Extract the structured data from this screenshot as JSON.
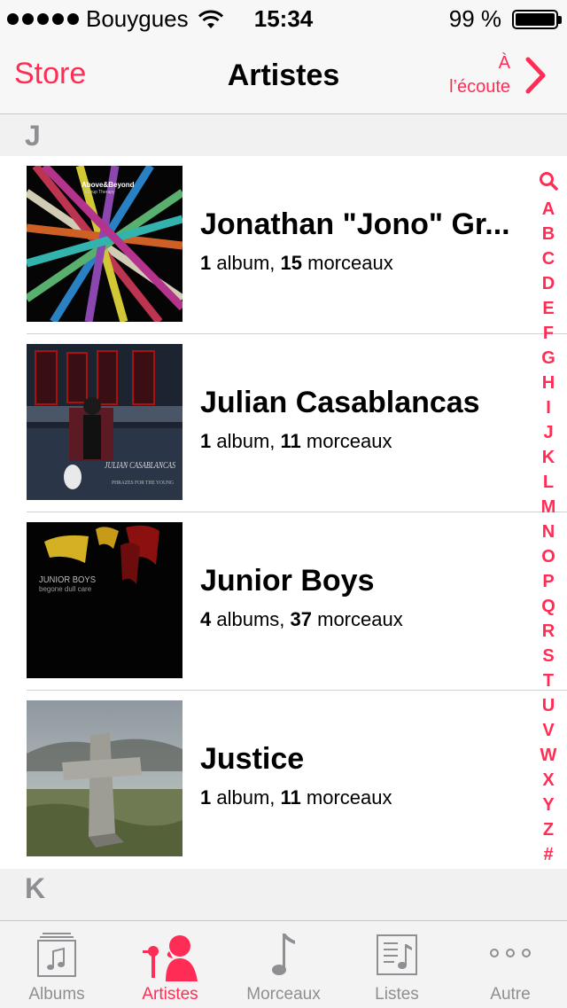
{
  "status_bar": {
    "carrier": "Bouygues",
    "time": "15:34",
    "battery_text": "99 %",
    "battery_level": 0.99
  },
  "nav": {
    "back_label": "Store",
    "title": "Artistes",
    "now_playing_line1": "À",
    "now_playing_line2": "l’écoute"
  },
  "sections": [
    {
      "letter": "J"
    },
    {
      "letter": "K"
    }
  ],
  "artists": [
    {
      "name": "Jonathan \"Jono\" Gr...",
      "albums_count": "1",
      "albums_word": " album, ",
      "tracks_count": "15",
      "tracks_word": " morceaux",
      "cover_text": "Above&Beyond",
      "cover_subtext": "Group Therapy"
    },
    {
      "name": "Julian Casablancas",
      "albums_count": "1",
      "albums_word": " album, ",
      "tracks_count": "11",
      "tracks_word": " morceaux",
      "cover_text": "JULIAN CASABLANCAS",
      "cover_subtext": "PHRAZES FOR THE YOUNG"
    },
    {
      "name": "Junior Boys",
      "albums_count": "4",
      "albums_word": " albums, ",
      "tracks_count": "37",
      "tracks_word": " morceaux",
      "cover_text": "JUNIOR BOYS",
      "cover_subtext": "begone dull care"
    },
    {
      "name": "Justice",
      "albums_count": "1",
      "albums_word": " album, ",
      "tracks_count": "11",
      "tracks_word": " morceaux"
    }
  ],
  "index_letters": [
    "A",
    "B",
    "C",
    "D",
    "E",
    "F",
    "G",
    "H",
    "I",
    "J",
    "K",
    "L",
    "M",
    "N",
    "O",
    "P",
    "Q",
    "R",
    "S",
    "T",
    "U",
    "V",
    "W",
    "X",
    "Y",
    "Z",
    "#"
  ],
  "tabs": [
    {
      "label": "Albums",
      "icon": "albums-icon"
    },
    {
      "label": "Artistes",
      "icon": "artist-icon"
    },
    {
      "label": "Morceaux",
      "icon": "music-note-icon"
    },
    {
      "label": "Listes",
      "icon": "playlist-icon"
    },
    {
      "label": "Autre",
      "icon": "more-icon"
    }
  ],
  "active_tab": "Artistes",
  "colors": {
    "accent": "#ff2d55",
    "inactive": "#8e8e93"
  }
}
